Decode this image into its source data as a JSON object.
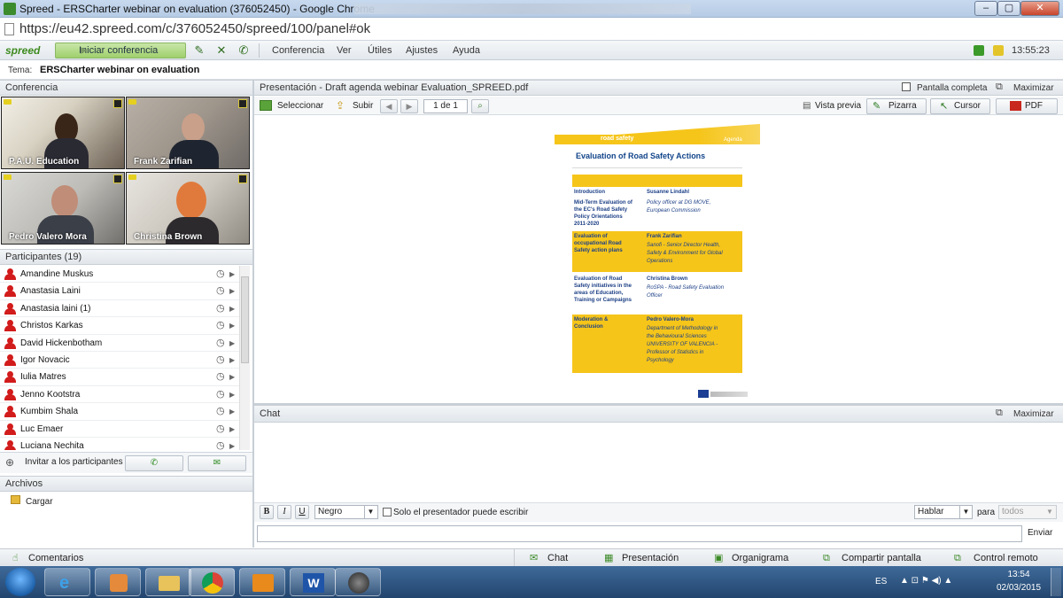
{
  "window": {
    "title": "Spreed - ERSCharter webinar on evaluation (376052450) - Google Chrome",
    "min": "–",
    "max": "▢",
    "close": "✕"
  },
  "browser": {
    "url": "https://eu42.spreed.com/c/376052450/spreed/100/panel#ok"
  },
  "app": {
    "logo": "spreed",
    "start_conference": "Iniciar conferencia",
    "menu": [
      "Conferencia",
      "Ver",
      "Útiles",
      "Ajustes",
      "Ayuda"
    ],
    "clock": "13:55:23",
    "topic_label": "Tema:",
    "topic": "ERSCharter webinar on evaluation"
  },
  "conference": {
    "header": "Conferencia",
    "videos": [
      {
        "name": "P.A.U. Education"
      },
      {
        "name": "Frank Zarifian"
      },
      {
        "name": "Pedro Valero Mora"
      },
      {
        "name": "Christina Brown"
      }
    ]
  },
  "participants": {
    "header": "Participantes (19)",
    "list": [
      "Amandine Muskus",
      "Anastasia Laini",
      "Anastasia laini (1)",
      "Christos Karkas",
      "David Hickenbotham",
      "Igor Novacic",
      "Iulia Matres",
      "Jenno Kootstra",
      "Kumbim Shala",
      "Luc Emaer",
      "Luciana Nechita"
    ],
    "invite": "Invitar a los participantes"
  },
  "files": {
    "header": "Archivos",
    "upload": "Cargar"
  },
  "presentation": {
    "header": "Presentación - Draft agenda webinar Evaluation_SPREED.pdf",
    "fullscreen": "Pantalla completa",
    "maximize": "Maximizar",
    "select": "Seleccionar",
    "upload": "Subir",
    "page": "1 de 1",
    "preview": "Vista previa",
    "whiteboard": "Pizarra",
    "cursor": "Cursor",
    "pdf": "PDF"
  },
  "slide": {
    "brand": "road safety",
    "agenda": "Agenda",
    "title": "Evaluation of Road Safety Actions",
    "rows": [
      {
        "left": [
          "Introduction"
        ],
        "right": [
          "Susanne Lindahl"
        ],
        "right_italic": [],
        "yellow": false
      },
      {
        "left": [
          "Mid-Term Evaluation of",
          "the EC's Road Safety",
          "Policy Orientations",
          "2011-2020"
        ],
        "right": [],
        "right_italic": [
          "Policy officer at DG MOVE,",
          "European Commission"
        ],
        "yellow": false
      },
      {
        "left": [
          "Evaluation of",
          "occupational Road",
          "Safety action plans"
        ],
        "right": [
          "Frank Zarifian"
        ],
        "right_italic": [
          "Sanofi - Senior Director Health,",
          "Safety & Environment for Global",
          "Operations"
        ],
        "yellow": true
      },
      {
        "left": [
          "Evaluation of Road",
          "Safety initiatives in the",
          "areas of Education,",
          "Training or Campaigns"
        ],
        "right": [
          "Christina Brown"
        ],
        "right_italic": [
          "RoSPA - Road Safety Evaluation",
          "Officer"
        ],
        "yellow": false
      },
      {
        "left": [
          "Moderation &",
          "Conclusion"
        ],
        "right": [
          "Pedro Valero-Mora"
        ],
        "right_italic": [
          "Department of Methodology in",
          "the Behavioural Sciences",
          "UNIVERSITY OF VALENCIA -",
          "Professor of Statistics in",
          "Psychology"
        ],
        "yellow": true
      }
    ]
  },
  "chat": {
    "header": "Chat",
    "maximize": "Maximizar",
    "color": "Negro",
    "presenter_only": "Solo el presentador puede escribir",
    "mode": "Hablar",
    "to_label": "para",
    "to": "todos",
    "send": "Enviar"
  },
  "bottom": {
    "comments": "Comentarios",
    "chat": "Chat",
    "presentation": "Presentación",
    "org": "Organigrama",
    "share": "Compartir pantalla",
    "remote": "Control remoto"
  },
  "taskbar": {
    "lang": "ES",
    "time": "13:54",
    "date": "02/03/2015"
  },
  "colors": {
    "accent_green": "#9fd06c",
    "slide_yellow": "#f6c51a",
    "participant_red": "#d21b1b",
    "taskbar_blue": "#2b5384"
  }
}
